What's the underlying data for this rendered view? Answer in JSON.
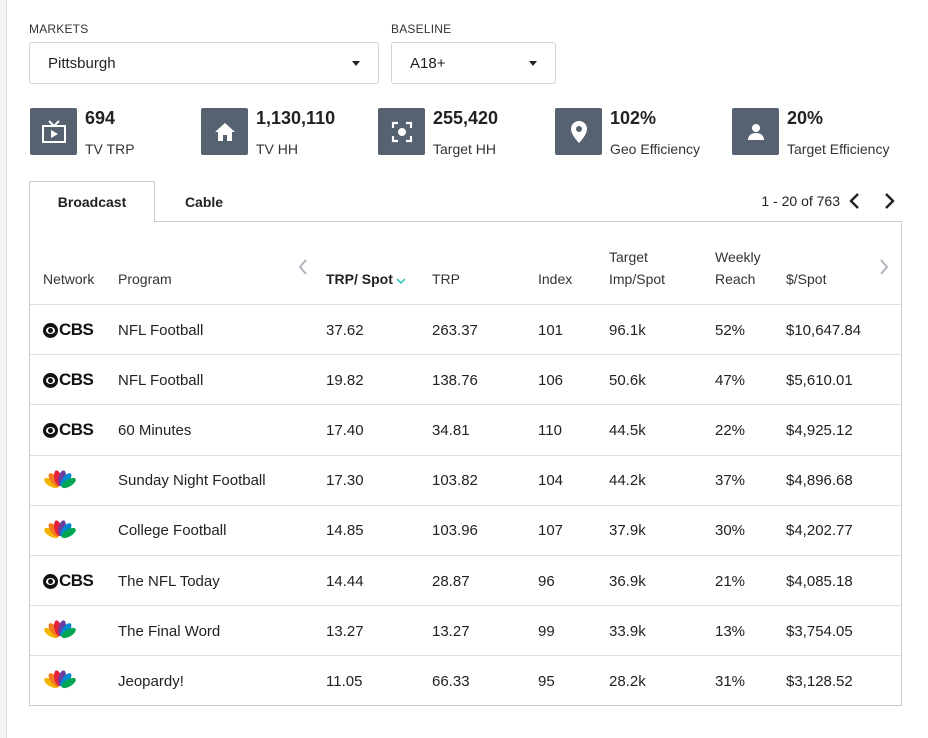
{
  "filters": {
    "markets_label": "MARKETS",
    "markets_value": "Pittsburgh",
    "baseline_label": "BASELINE",
    "baseline_value": "A18+"
  },
  "stats": [
    {
      "value": "694",
      "label": "TV TRP",
      "icon": "tv-icon"
    },
    {
      "value": "1,130,110",
      "label": "TV HH",
      "icon": "home-icon"
    },
    {
      "value": "255,420",
      "label": "Target HH",
      "icon": "target-icon"
    },
    {
      "value": "102%",
      "label": "Geo Efficiency",
      "icon": "location-pin-icon"
    },
    {
      "value": "20%",
      "label": "Target Efficiency",
      "icon": "person-icon"
    }
  ],
  "tabs": [
    {
      "label": "Broadcast",
      "active": true
    },
    {
      "label": "Cable",
      "active": false
    }
  ],
  "pagination": {
    "text": "1 - 20 of 763"
  },
  "table": {
    "headers": {
      "network": "Network",
      "program": "Program",
      "trp_spot": "TRP/ Spot",
      "trp": "TRP",
      "index": "Index",
      "target_imp_line1": "Target",
      "target_imp_line2": "Imp/Spot",
      "weekly_line1": "Weekly",
      "weekly_line2": "Reach",
      "cost_spot": "$/Spot"
    },
    "sort_color": "#3cc8c8",
    "rows": [
      {
        "network": "CBS",
        "program": "NFL Football",
        "trp_spot": "37.62",
        "trp": "263.37",
        "index": "101",
        "imp": "96.1k",
        "reach": "52%",
        "cost": "$10,647.84"
      },
      {
        "network": "CBS",
        "program": "NFL Football",
        "trp_spot": "19.82",
        "trp": "138.76",
        "index": "106",
        "imp": "50.6k",
        "reach": "47%",
        "cost": "$5,610.01"
      },
      {
        "network": "CBS",
        "program": "60 Minutes",
        "trp_spot": "17.40",
        "trp": "34.81",
        "index": "110",
        "imp": "44.5k",
        "reach": "22%",
        "cost": "$4,925.12"
      },
      {
        "network": "NBC",
        "program": "Sunday Night Football",
        "trp_spot": "17.30",
        "trp": "103.82",
        "index": "104",
        "imp": "44.2k",
        "reach": "37%",
        "cost": "$4,896.68"
      },
      {
        "network": "NBC",
        "program": "College Football",
        "trp_spot": "14.85",
        "trp": "103.96",
        "index": "107",
        "imp": "37.9k",
        "reach": "30%",
        "cost": "$4,202.77"
      },
      {
        "network": "CBS",
        "program": "The NFL Today",
        "trp_spot": "14.44",
        "trp": "28.87",
        "index": "96",
        "imp": "36.9k",
        "reach": "21%",
        "cost": "$4,085.18"
      },
      {
        "network": "NBC",
        "program": "The Final Word",
        "trp_spot": "13.27",
        "trp": "13.27",
        "index": "99",
        "imp": "33.9k",
        "reach": "13%",
        "cost": "$3,754.05"
      },
      {
        "network": "NBC",
        "program": "Jeopardy!",
        "trp_spot": "11.05",
        "trp": "66.33",
        "index": "95",
        "imp": "28.2k",
        "reach": "31%",
        "cost": "$3,128.52"
      }
    ]
  },
  "colors": {
    "icon_bg": "#566270",
    "nbc": [
      "#f5b400",
      "#f47a20",
      "#e4203a",
      "#6a3fa0",
      "#0089d0",
      "#00a651"
    ]
  }
}
